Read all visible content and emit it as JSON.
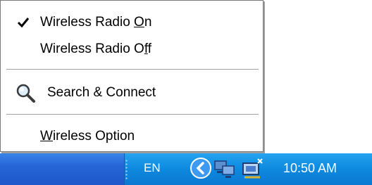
{
  "menu": {
    "items": [
      {
        "label_before": "Wireless Radio ",
        "label_ul": "O",
        "label_after": "n",
        "checked": true
      },
      {
        "label_before": "Wireless Radio O",
        "label_ul": "f",
        "label_after": "f",
        "checked": false
      },
      {
        "label": "Search & Connect",
        "icon": "magnifier-icon"
      },
      {
        "label_before": "",
        "label_ul": "W",
        "label_after": "ireless Option"
      }
    ]
  },
  "taskbar": {
    "language": "EN",
    "clock": "10:50 AM"
  },
  "colors": {
    "taskbar_blue": "#2565d8",
    "tray_blue": "#0f8be0",
    "menu_bg": "#ffffff"
  }
}
